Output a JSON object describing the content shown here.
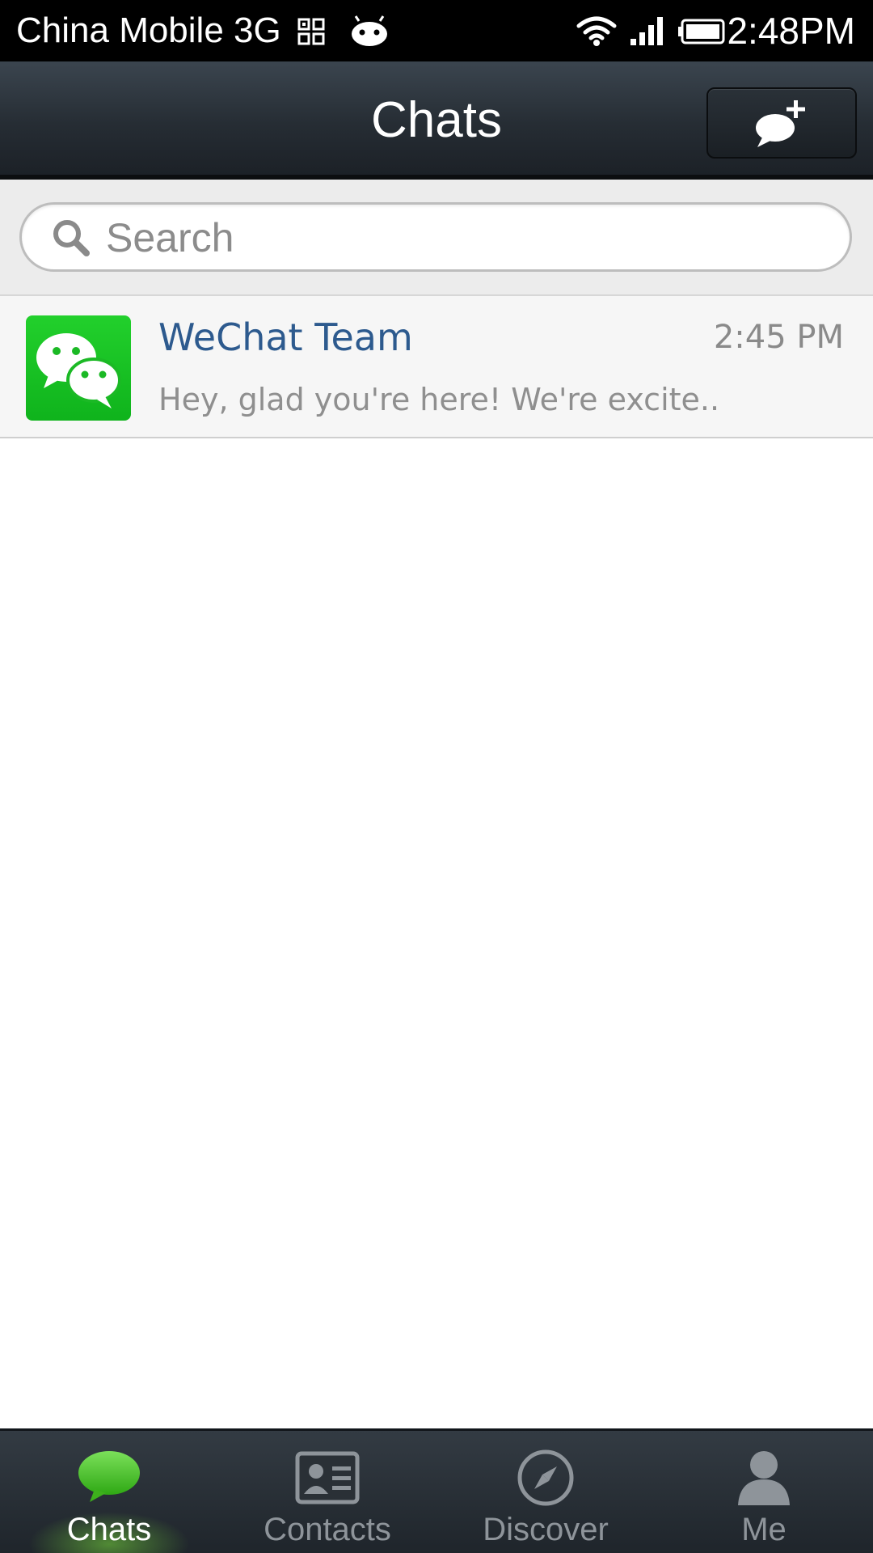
{
  "status_bar": {
    "carrier": "China Mobile 3G",
    "time": "2:48PM",
    "icons": [
      "qr-code-icon",
      "android-icon",
      "wifi-icon",
      "cellular-signal-icon",
      "battery-icon"
    ]
  },
  "header": {
    "title": "Chats",
    "compose_icon": "add-chat-bubble-icon"
  },
  "search": {
    "placeholder": "Search",
    "value": ""
  },
  "chats": [
    {
      "name": "WeChat Team",
      "time": "2:45 PM",
      "preview": "Hey, glad you're here! We're excite..",
      "avatar": "wechat-logo-icon"
    }
  ],
  "tabs": [
    {
      "label": "Chats",
      "icon": "chat-bubble-icon",
      "active": true
    },
    {
      "label": "Contacts",
      "icon": "contact-card-icon",
      "active": false
    },
    {
      "label": "Discover",
      "icon": "compass-icon",
      "active": false
    },
    {
      "label": "Me",
      "icon": "person-icon",
      "active": false
    }
  ],
  "colors": {
    "status_bar": "#000000",
    "header": "#262d34",
    "accent_green": "#1fc22a",
    "chat_name": "#2d5a8e",
    "tab_bar": "#262d34"
  }
}
